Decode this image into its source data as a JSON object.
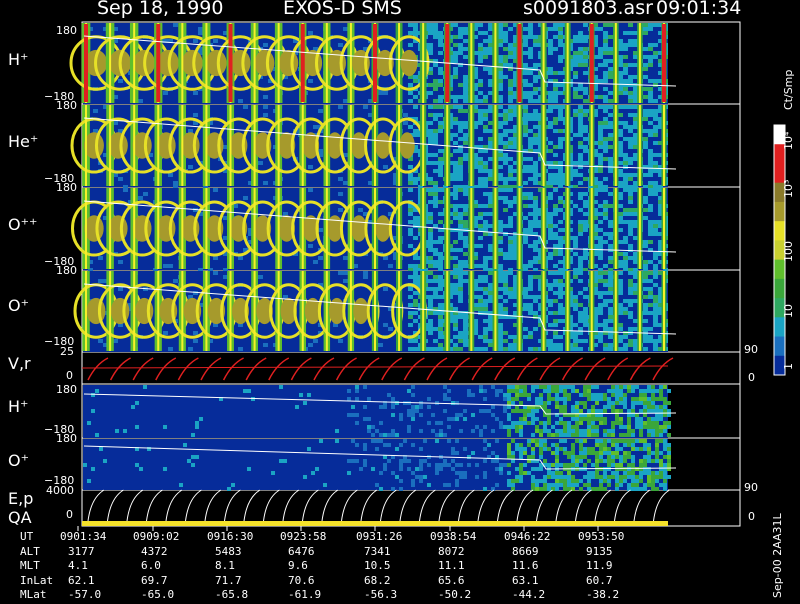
{
  "header": {
    "date": "Sep 18, 1990",
    "mission": "EXOS-D SMS",
    "filename": "s0091803.asr",
    "time": "09:01:34"
  },
  "colorbar": {
    "unit": "Ct/Smp",
    "labels": [
      "10⁴",
      "10³",
      "100",
      "10",
      "1"
    ]
  },
  "footer_id": "Sep-00 2AA31L",
  "chart_data": {
    "type": "heatmap",
    "panels": [
      {
        "label": "H⁺",
        "ymax": "180",
        "ymin": "−180"
      },
      {
        "label": "He⁺",
        "ymax": "180",
        "ymin": "−180"
      },
      {
        "label": "O⁺⁺",
        "ymax": "180",
        "ymin": "−180"
      },
      {
        "label": "O⁺",
        "ymax": "180",
        "ymin": "−180"
      },
      {
        "label": "V,r",
        "ymax": "25",
        "ymin": "0",
        "right_max": "90",
        "right_min": "0"
      },
      {
        "label": "H⁺",
        "ymax": "180",
        "ymin": "−180"
      },
      {
        "label": "O⁺",
        "ymax": "180",
        "ymin": "−180"
      },
      {
        "label": "E,p",
        "label2": "QA",
        "ymax": "4000",
        "ymin": "0",
        "right_max": "90",
        "right_min": "0"
      }
    ],
    "table": {
      "rows": [
        {
          "name": "UT",
          "values": [
            "0901:34",
            "0909:02",
            "0916:30",
            "0923:58",
            "0931:26",
            "0938:54",
            "0946:22",
            "0953:50"
          ]
        },
        {
          "name": "ALT",
          "values": [
            "3177",
            "4372",
            "5483",
            "6476",
            "7341",
            "8072",
            "8669",
            "9135"
          ]
        },
        {
          "name": "MLT",
          "values": [
            "4.1",
            "6.0",
            "8.1",
            "9.6",
            "10.5",
            "11.1",
            "11.6",
            "11.9"
          ]
        },
        {
          "name": "InLat",
          "values": [
            "62.1",
            "69.7",
            "71.7",
            "70.6",
            "68.2",
            "65.6",
            "63.1",
            "60.7"
          ]
        },
        {
          "name": "MLat",
          "values": [
            "-57.0",
            "-65.0",
            "-65.8",
            "-61.9",
            "-56.3",
            "-50.2",
            "-44.2",
            "-38.2"
          ]
        }
      ]
    }
  }
}
